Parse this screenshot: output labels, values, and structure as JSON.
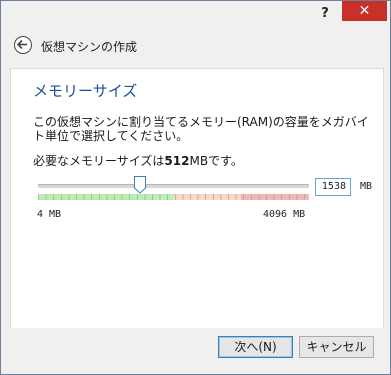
{
  "titlebar": {
    "help_label": "?",
    "close_label": "✕"
  },
  "header": {
    "title": "仮想マシンの作成",
    "back_icon": "back-arrow-icon"
  },
  "section": {
    "title": "メモリーサイズ",
    "description": "この仮想マシンに割り当てるメモリー(RAM)の容量をメガバイト単位で選択してください。",
    "recommend_prefix": "必要なメモリーサイズは",
    "recommend_value": "512",
    "recommend_suffix": "MBです。"
  },
  "slider": {
    "min_label": "4 MB",
    "max_label": "4096 MB",
    "value": 1538,
    "min": 4,
    "max": 4096,
    "zones": {
      "green_until": 2048,
      "orange_until": 3072
    }
  },
  "memory_field": {
    "value": "1538",
    "unit": "MB"
  },
  "buttons": {
    "next": "次へ(N)",
    "cancel": "キャンセル"
  },
  "colors": {
    "title_blue": "#1e4f9b",
    "close_red": "#c7312a"
  }
}
